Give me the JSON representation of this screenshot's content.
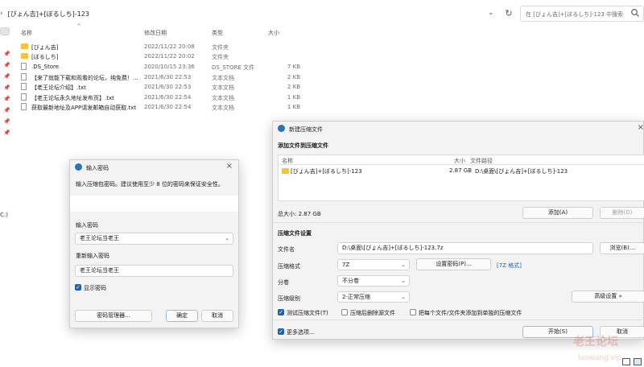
{
  "explorer": {
    "path": "[びょん吉]+[ぼるしち]-123",
    "search_placeholder": "在 [びょん吉]+[ぼるしち]-123 中搜索",
    "columns": {
      "name": "名称",
      "date": "修改日期",
      "type": "类型",
      "size": "大小"
    },
    "files": [
      {
        "name": "[びょん吉]",
        "date": "2022/11/22 20:08",
        "type": "文件夹",
        "size": "",
        "icon": "folder-icon"
      },
      {
        "name": "[ぼるしち]",
        "date": "2022/11/22 20:02",
        "type": "文件夹",
        "size": "",
        "icon": "folder-icon"
      },
      {
        "name": ".DS_Store",
        "date": "2020/10/15 23:36",
        "type": "DS_STORE 文件",
        "size": "7 KB",
        "icon": "file-icon"
      },
      {
        "name": "【来了就能下载和观看的论坛，纯免费！...",
        "date": "2021/6/30 22:53",
        "type": "文本文档",
        "size": "2 KB",
        "icon": "text-file-icon"
      },
      {
        "name": "【老王论坛介绍】.txt",
        "date": "2021/6/30 22:53",
        "type": "文本文档",
        "size": "2 KB",
        "icon": "text-file-icon"
      },
      {
        "name": "【老王论坛永久地址发布页】.txt",
        "date": "2021/6/30 22:54",
        "type": "文本文档",
        "size": "1 KB",
        "icon": "text-file-icon"
      },
      {
        "name": "获取最新地址及APP请发邮箱自动获取.txt",
        "date": "2021/6/30 22:54",
        "type": "文本文档",
        "size": "1 KB",
        "icon": "text-file-icon"
      }
    ],
    "drive_label": "C:)"
  },
  "password_dialog": {
    "title": "输入密码",
    "prompt": "输入压缩包密码。建议使用至少 8 位的密码来保证安全性。",
    "enter_label": "输入密码",
    "enter_value": "老王论坛当老王",
    "reenter_label": "重新输入密码",
    "reenter_value": "老王论坛当老王",
    "show_password": "显示密码",
    "manager_btn": "密码管理器...",
    "ok_btn": "确定",
    "cancel_btn": "取消"
  },
  "archive_dialog": {
    "title": "新建压缩文件",
    "add_section": "添加文件到压缩文件",
    "col_name": "名称",
    "col_size": "大小",
    "col_path": "文件路径",
    "item_name": "[びょん吉]+[ぼるしち]-123",
    "item_size": "2.87 GB",
    "item_path": "D:\\桌面\\[びょん吉]+[ぼるしち]-123",
    "total": "总大小: 2.87 GB",
    "add_btn": "添加(A)",
    "remove_btn": "删除(D)",
    "settings_section": "压缩文件设置",
    "filename_label": "文件名",
    "filename_value": "D:\\桌面\\[びょん吉]+[ぼるしち]-123.7z",
    "browse_btn": "浏览(B)...",
    "format_label": "压缩格式",
    "format_value": "7Z",
    "setpw_btn": "设置密码(P)...",
    "format_tag": "[7Z 格式]",
    "split_label": "分卷",
    "split_value": "不分卷",
    "level_label": "压缩级别",
    "level_value": "2-正常压缩",
    "advanced_btn": "高级设置 »",
    "test_opt": "测试压缩文件(T)",
    "delete_opt": "压缩后删除源文件",
    "separate_opt": "把每个文件/文件夹添加到单独的压缩文件",
    "more_opt": "更多选项...",
    "start_btn": "开始(S)",
    "cancel_btn": "取消"
  },
  "watermark": {
    "line1": "老王论坛",
    "line2": "laowang.vip"
  }
}
